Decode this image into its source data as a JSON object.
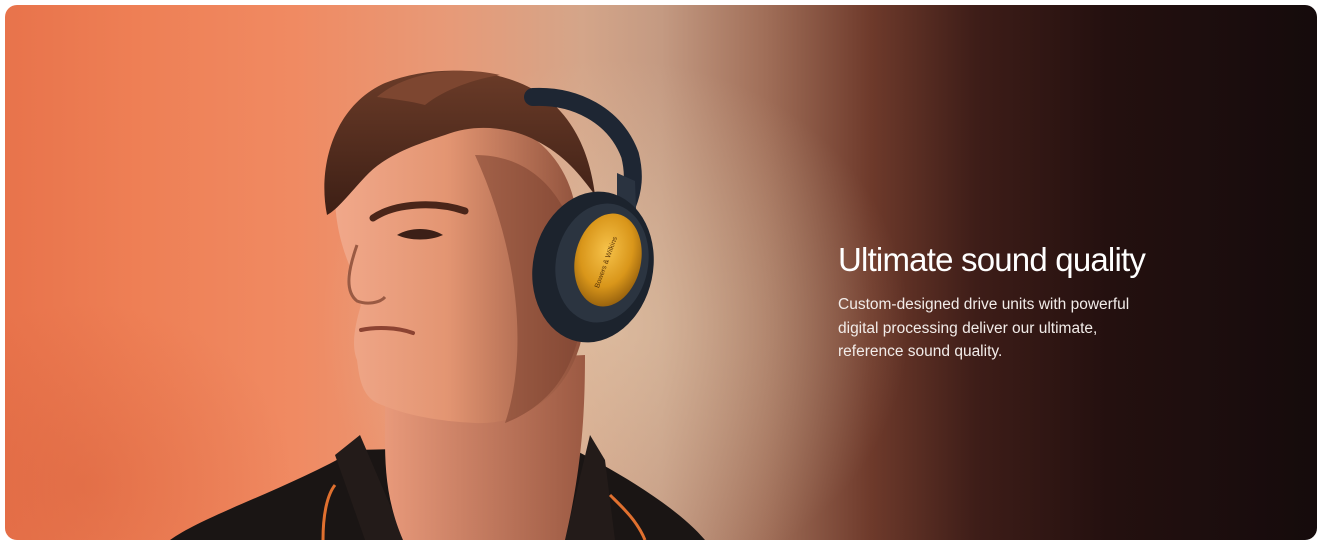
{
  "banner": {
    "headline": "Ultimate sound quality",
    "description": "Custom-designed drive units with powerful digital processing deliver our ultimate, reference sound quality.",
    "earcup_brand": "Bowers & Wilkins"
  },
  "colors": {
    "accent_orange": "#ee7f55",
    "dark_end": "#150b0c",
    "earcup_gold": "#d9961a",
    "headphone_navy": "#1e2633"
  },
  "icons": {
    "hero_image": "person-wearing-headphones"
  }
}
